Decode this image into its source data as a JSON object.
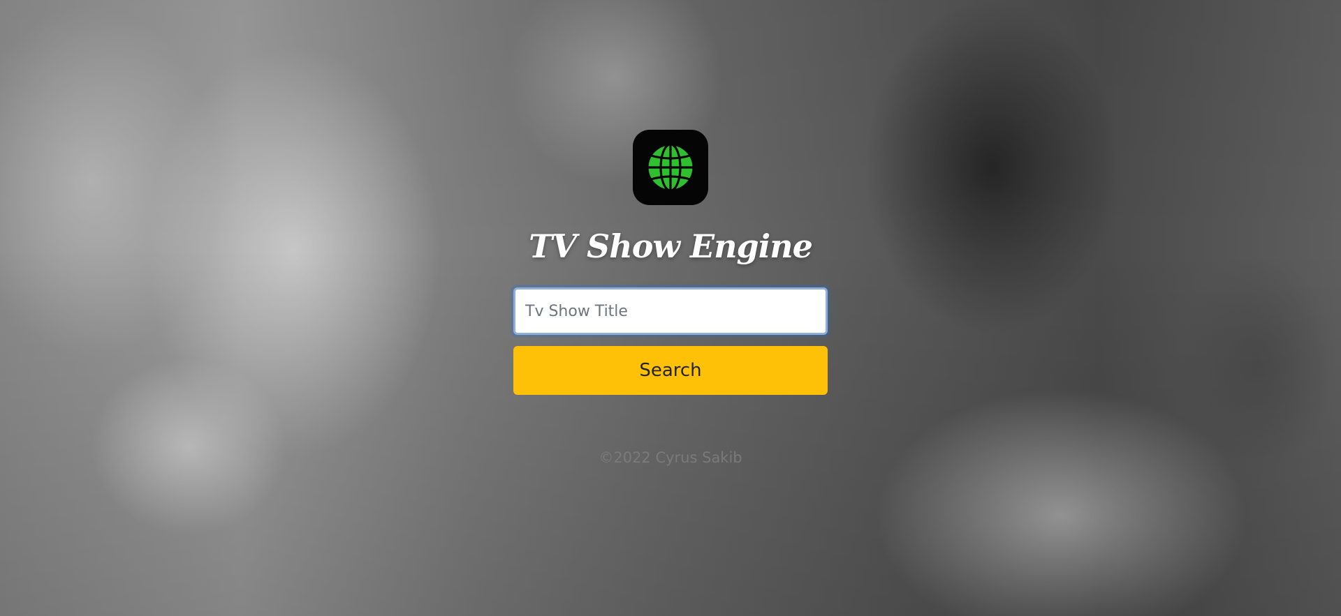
{
  "app": {
    "title": "TV Show Engine",
    "logo_icon": "globe-icon",
    "logo_color": "#2fc02f"
  },
  "search": {
    "placeholder": "Tv Show Title",
    "value": "",
    "button_label": "Search",
    "button_color": "#ffc107"
  },
  "footer": {
    "copyright": "©2022 Cyrus Sakib"
  }
}
